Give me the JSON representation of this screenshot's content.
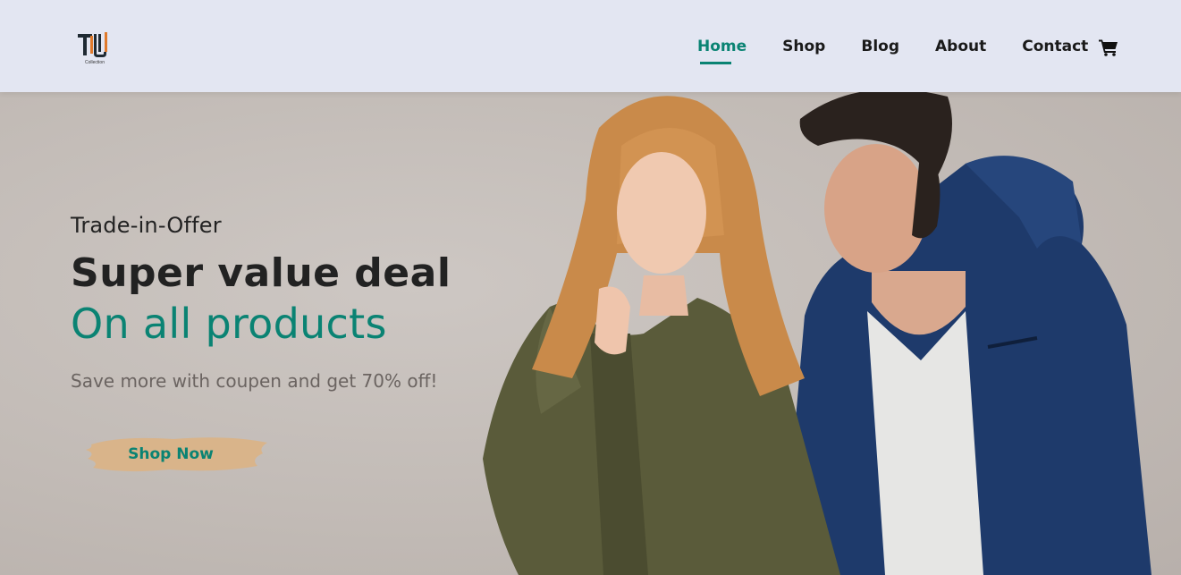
{
  "brand": {
    "caption": "Collection",
    "colors": {
      "dark": "#1f2a33",
      "orange": "#e07a2c"
    }
  },
  "nav": {
    "items": [
      {
        "label": "Home",
        "active": true
      },
      {
        "label": "Shop",
        "active": false
      },
      {
        "label": "Blog",
        "active": false
      },
      {
        "label": "About",
        "active": false
      },
      {
        "label": "Contact",
        "active": false
      }
    ],
    "cart_icon": "shopping-cart-icon"
  },
  "hero": {
    "eyebrow": "Trade-in-Offer",
    "headline": "Super value deal",
    "subheadline": "On all products",
    "blurb": "Save more with coupen and get 70% off!",
    "cta_label": "Shop Now",
    "image": "couple-in-winter-jackets-photo"
  },
  "colors": {
    "accent": "#0a8373",
    "header_bg": "#e3e6f2",
    "hero_bg": "#c4bdb8",
    "cta_brush": "#d9b48a",
    "text_dark": "#222222",
    "text_muted": "#6b6461"
  }
}
